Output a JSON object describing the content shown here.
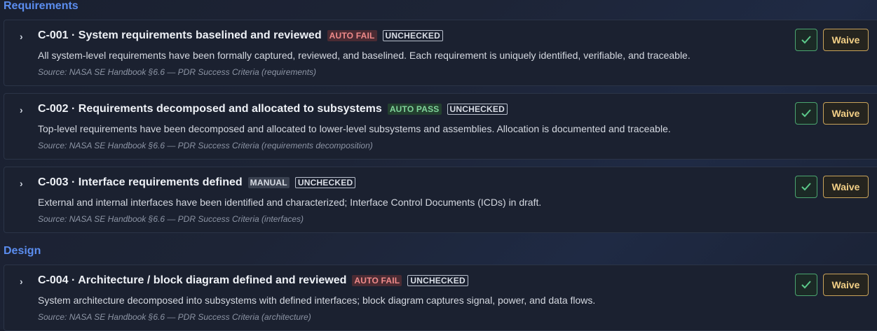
{
  "sections": [
    {
      "title": "Requirements",
      "items": [
        {
          "id_title": "C-001 · System requirements baselined and reviewed",
          "auto_badge": "AUTO FAIL",
          "status_badge": "UNCHECKED",
          "description": "All system-level requirements have been formally captured, reviewed, and baselined. Each requirement is uniquely identified, verifiable, and traceable.",
          "source": "Source: NASA SE Handbook §6.6 — PDR Success Criteria (requirements)",
          "waive_label": "Waive"
        },
        {
          "id_title": "C-002 · Requirements decomposed and allocated to subsystems",
          "auto_badge": "AUTO PASS",
          "status_badge": "UNCHECKED",
          "description": "Top-level requirements have been decomposed and allocated to lower-level subsystems and assemblies. Allocation is documented and traceable.",
          "source": "Source: NASA SE Handbook §6.6 — PDR Success Criteria (requirements decomposition)",
          "waive_label": "Waive"
        },
        {
          "id_title": "C-003 · Interface requirements defined",
          "auto_badge": "MANUAL",
          "status_badge": "UNCHECKED",
          "description": "External and internal interfaces have been identified and characterized; Interface Control Documents (ICDs) in draft.",
          "source": "Source: NASA SE Handbook §6.6 — PDR Success Criteria (interfaces)",
          "waive_label": "Waive"
        }
      ]
    },
    {
      "title": "Design",
      "items": [
        {
          "id_title": "C-004 · Architecture / block diagram defined and reviewed",
          "auto_badge": "AUTO FAIL",
          "status_badge": "UNCHECKED",
          "description": "System architecture decomposed into subsystems with defined interfaces; block diagram captures signal, power, and data flows.",
          "source": "Source: NASA SE Handbook §6.6 — PDR Success Criteria (architecture)",
          "waive_label": "Waive"
        }
      ]
    }
  ],
  "icons": {
    "expand": "chevron-right-icon",
    "approve": "check-icon"
  },
  "colors": {
    "section_title": "#5b8def",
    "fail": "#f08a8a",
    "pass": "#7fd49a",
    "waive": "#f2cf86",
    "check": "#5cc98a"
  }
}
